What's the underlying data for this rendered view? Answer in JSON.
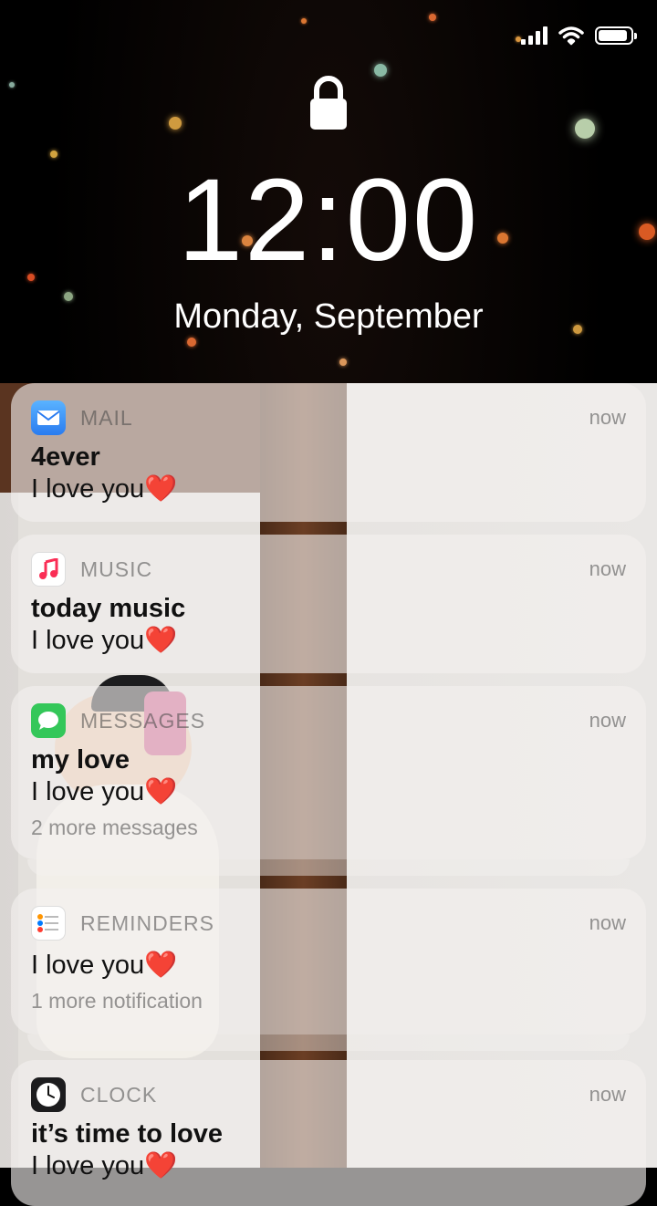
{
  "status_bar": {
    "signal_bars": 4,
    "wifi": true,
    "battery_level": 0.9
  },
  "lock": {
    "time": "12:00",
    "date": "Monday, September"
  },
  "notifications": [
    {
      "app": "MAIL",
      "icon": "mail-icon",
      "time": "now",
      "title": "4ever",
      "body": "I love you❤️",
      "extra": ""
    },
    {
      "app": "MUSIC",
      "icon": "music-icon",
      "time": "now",
      "title": "today music",
      "body": "I love you❤️",
      "extra": ""
    },
    {
      "app": "MESSAGES",
      "icon": "messages-icon",
      "time": "now",
      "title": "my love",
      "body": "I love you❤️",
      "extra": "2 more messages"
    },
    {
      "app": "REMINDERS",
      "icon": "reminders-icon",
      "time": "now",
      "title": "",
      "body": "I love you❤️",
      "extra": "1 more notification"
    },
    {
      "app": "CLOCK",
      "icon": "clock-icon",
      "time": "now",
      "title": "it’s time to love",
      "body": "I love you❤️",
      "extra": ""
    }
  ],
  "colors": {
    "mail_icon": "#3b8ff0",
    "messages_icon": "#34c759",
    "background": "#000000"
  }
}
